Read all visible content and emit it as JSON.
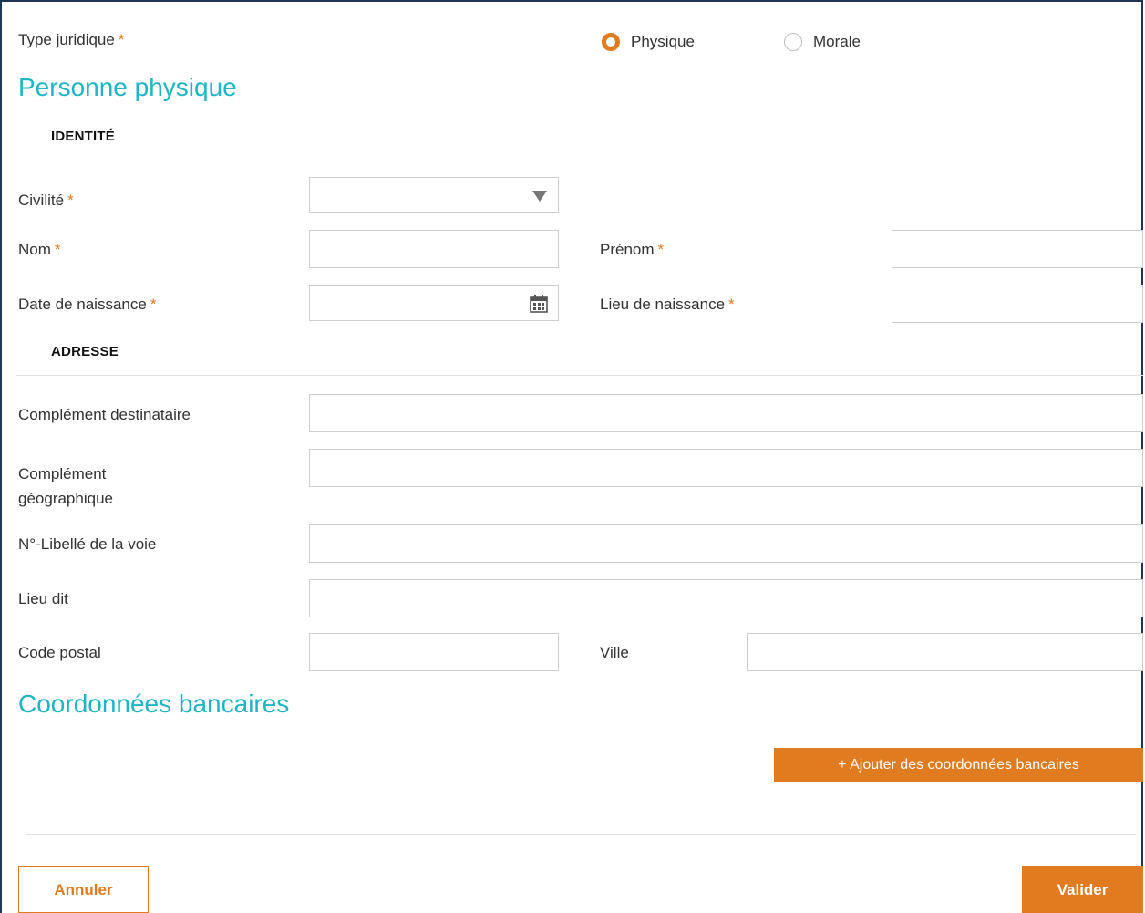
{
  "type_juridique": {
    "label": "Type juridique",
    "required_mark": "*",
    "options": [
      {
        "label": "Physique",
        "selected": true
      },
      {
        "label": "Morale",
        "selected": false
      }
    ]
  },
  "section_personne": {
    "title": "Personne physique",
    "identite": {
      "title": "IDENTITÉ",
      "civilite": {
        "label": "Civilité",
        "value": ""
      },
      "nom": {
        "label": "Nom",
        "value": ""
      },
      "prenom": {
        "label": "Prénom",
        "value": ""
      },
      "date_naissance": {
        "label": "Date de naissance",
        "value": ""
      },
      "lieu_naissance": {
        "label": "Lieu de naissance",
        "value": ""
      },
      "required_mark": "*"
    },
    "adresse": {
      "title": "ADRESSE",
      "complement_destinataire": {
        "label": "Complément destinataire",
        "value": ""
      },
      "complement_geographique": {
        "label_line1": "Complément",
        "label_line2": "géographique",
        "value": ""
      },
      "voie": {
        "label": "N°-Libellé de la voie",
        "value": ""
      },
      "lieu_dit": {
        "label": "Lieu dit",
        "value": ""
      },
      "code_postal": {
        "label": "Code postal",
        "value": ""
      },
      "ville": {
        "label": "Ville",
        "value": ""
      }
    }
  },
  "section_bancaire": {
    "title": "Coordonnées bancaires",
    "add_button": "+ Ajouter des coordonnées bancaires"
  },
  "footer": {
    "cancel": "Annuler",
    "submit": "Valider"
  },
  "colors": {
    "accent": "#e07b1f",
    "section_title": "#1eb6c4",
    "border": "#cfcfcf"
  }
}
